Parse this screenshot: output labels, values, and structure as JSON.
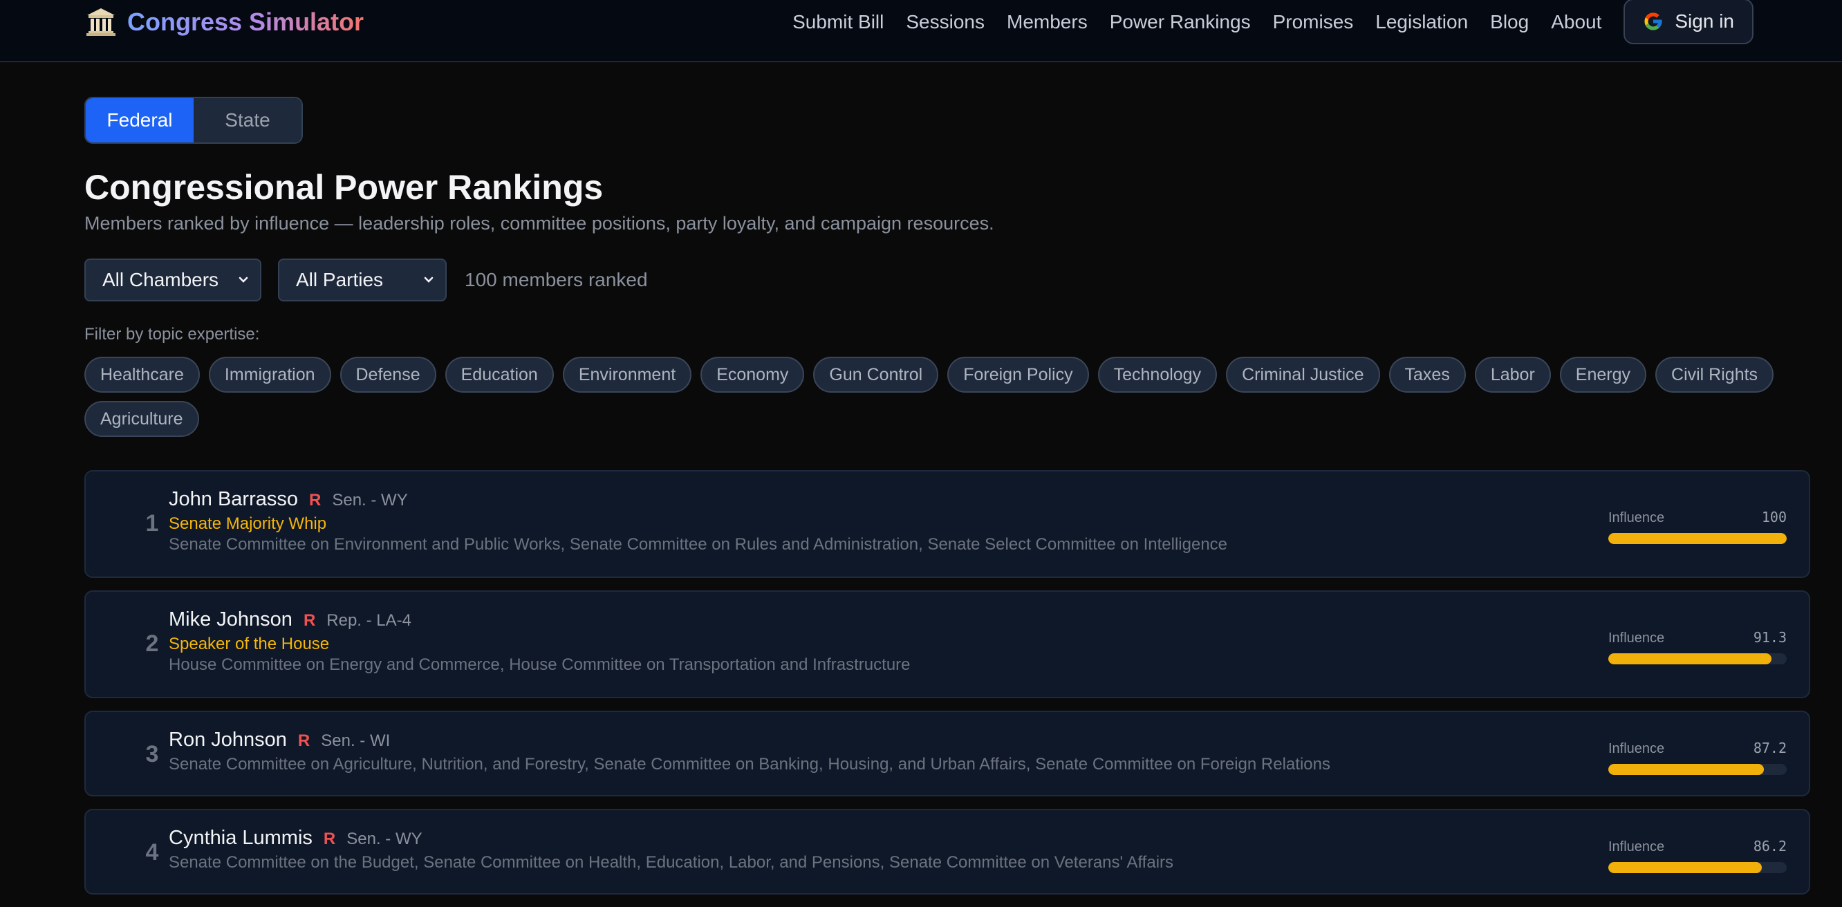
{
  "app": {
    "name": "Congress Simulator",
    "brand_icon": "classical-building-icon"
  },
  "nav": {
    "links": [
      "Submit Bill",
      "Sessions",
      "Members",
      "Power Rankings",
      "Promises",
      "Legislation",
      "Blog",
      "About"
    ],
    "signin_label": "Sign in",
    "signin_icon": "google-g-icon"
  },
  "scope_toggle": {
    "options": [
      "Federal",
      "State"
    ],
    "selected": "Federal"
  },
  "page": {
    "title": "Congressional Power Rankings",
    "subtitle": "Members ranked by influence — leadership roles, committee positions, party loyalty, and campaign resources."
  },
  "filters": {
    "chamber": "All Chambers",
    "party": "All Parties",
    "count_text": "100 members ranked",
    "topic_label": "Filter by topic expertise:",
    "topics": [
      "Healthcare",
      "Immigration",
      "Defense",
      "Education",
      "Environment",
      "Economy",
      "Gun Control",
      "Foreign Policy",
      "Technology",
      "Criminal Justice",
      "Taxes",
      "Labor",
      "Energy",
      "Civil Rights",
      "Agriculture"
    ]
  },
  "influence_label": "Influence",
  "members": [
    {
      "rank": "1",
      "name": "John Barrasso",
      "party": "R",
      "seat": "Sen. - WY",
      "role": "Senate Majority Whip",
      "committees": "Senate Committee on Environment and Public Works, Senate Committee on Rules and Administration, Senate Select Committee on Intelligence",
      "influence": "100",
      "influence_value": 100
    },
    {
      "rank": "2",
      "name": "Mike Johnson",
      "party": "R",
      "seat": "Rep. - LA-4",
      "role": "Speaker of the House",
      "committees": "House Committee on Energy and Commerce, House Committee on Transportation and Infrastructure",
      "influence": "91.3",
      "influence_value": 91.3
    },
    {
      "rank": "3",
      "name": "Ron Johnson",
      "party": "R",
      "seat": "Sen. - WI",
      "role": "",
      "committees": "Senate Committee on Agriculture, Nutrition, and Forestry, Senate Committee on Banking, Housing, and Urban Affairs, Senate Committee on Foreign Relations",
      "influence": "87.2",
      "influence_value": 87.2
    },
    {
      "rank": "4",
      "name": "Cynthia Lummis",
      "party": "R",
      "seat": "Sen. - WY",
      "role": "",
      "committees": "Senate Committee on the Budget, Senate Committee on Health, Education, Labor, and Pensions, Senate Committee on Veterans' Affairs",
      "influence": "86.2",
      "influence_value": 86.2
    }
  ],
  "colors": {
    "accent": "#1d63f5",
    "party_r": "#f05252",
    "role": "#f5b50a",
    "influence_bar": "#f2b10a"
  }
}
